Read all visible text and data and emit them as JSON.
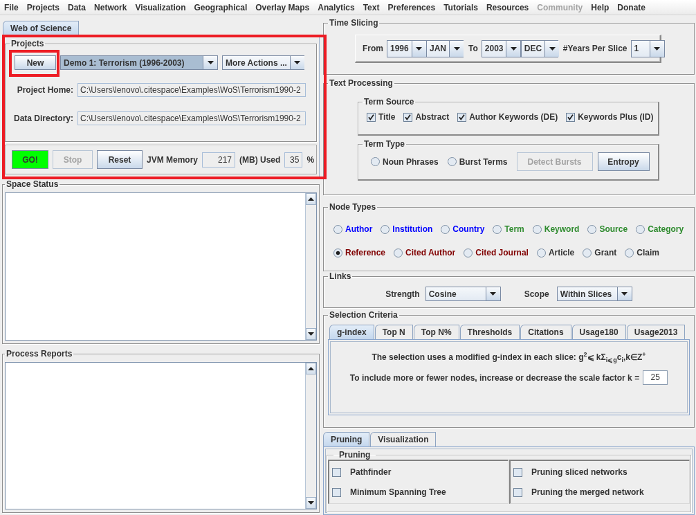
{
  "menu": [
    {
      "label": "File",
      "disabled": false
    },
    {
      "label": "Projects",
      "disabled": false
    },
    {
      "label": "Data",
      "disabled": false
    },
    {
      "label": "Network",
      "disabled": false
    },
    {
      "label": "Visualization",
      "disabled": false
    },
    {
      "label": "Geographical",
      "disabled": false
    },
    {
      "label": "Overlay Maps",
      "disabled": false
    },
    {
      "label": "Analytics",
      "disabled": false
    },
    {
      "label": "Text",
      "disabled": false
    },
    {
      "label": "Preferences",
      "disabled": false
    },
    {
      "label": "Tutorials",
      "disabled": false
    },
    {
      "label": "Resources",
      "disabled": false
    },
    {
      "label": "Community",
      "disabled": true
    },
    {
      "label": "Help",
      "disabled": false
    },
    {
      "label": "Donate",
      "disabled": false
    }
  ],
  "source_tabs": [
    {
      "label": "Web of Science",
      "selected": true
    }
  ],
  "project_panel": {
    "highlighted": true,
    "title": "Projects",
    "new_button": {
      "label": "New",
      "highlighted": true
    },
    "project_dropdown": {
      "value": "Demo 1: Terrorism (1996-2003)",
      "focused": true
    },
    "actions_dropdown": {
      "value": "More Actions ..."
    },
    "fields": [
      {
        "label": "Project Home:",
        "value": "C:\\Users\\lenovo\\.citespace\\Examples\\WoS\\Terrorism1990-2"
      },
      {
        "label": "Data Directory:",
        "value": "C:\\Users\\lenovo\\.citespace\\Examples\\WoS\\Terrorism1990-2"
      }
    ],
    "run_bar": {
      "buttons": [
        {
          "label": "GO!",
          "kind": "go",
          "disabled": false
        },
        {
          "label": "Stop",
          "kind": "push",
          "disabled": true
        },
        {
          "label": "Reset",
          "kind": "push",
          "disabled": false
        }
      ],
      "memory_label": "JVM Memory",
      "memory_value": "217",
      "used_label": "(MB) Used",
      "used_value": "35",
      "percent_label": "%"
    }
  },
  "space_status": {
    "title": "Space Status"
  },
  "process_reports": {
    "title": "Process Reports"
  },
  "time_slicing": {
    "title": "Time Slicing",
    "from_label": "From",
    "from_year": "1996",
    "from_month": "JAN",
    "to_label": "To",
    "to_year": "2003",
    "to_month": "DEC",
    "slice_label": "#Years Per Slice",
    "slice_value": "1"
  },
  "text_processing": {
    "title": "Text Processing",
    "term_source": {
      "title": "Term Source",
      "options": [
        {
          "label": "Title",
          "checked": true
        },
        {
          "label": "Abstract",
          "checked": true
        },
        {
          "label": "Author Keywords (DE)",
          "checked": true
        },
        {
          "label": "Keywords Plus (ID)",
          "checked": true
        }
      ]
    },
    "term_type": {
      "title": "Term Type",
      "options": [
        {
          "label": "Noun Phrases",
          "selected": false
        },
        {
          "label": "Burst Terms",
          "selected": false
        }
      ],
      "buttons": [
        {
          "label": "Detect Bursts",
          "disabled": true
        },
        {
          "label": "Entropy",
          "disabled": false
        }
      ]
    }
  },
  "node_types": {
    "title": "Node Types",
    "rows": [
      {
        "options": [
          {
            "label": "Author",
            "color": "#0000ff",
            "selected": false
          },
          {
            "label": "Institution",
            "color": "#0000ff",
            "selected": false
          },
          {
            "label": "Country",
            "color": "#0000ff",
            "selected": false
          },
          {
            "label": "Term",
            "color": "#2e8b2e",
            "selected": false
          },
          {
            "label": "Keyword",
            "color": "#2e8b2e",
            "selected": false
          },
          {
            "label": "Source",
            "color": "#2e8b2e",
            "selected": false
          },
          {
            "label": "Category",
            "color": "#2e8b2e",
            "selected": false
          }
        ]
      },
      {
        "options": [
          {
            "label": "Reference",
            "color": "#800000",
            "selected": true
          },
          {
            "label": "Cited Author",
            "color": "#800000",
            "selected": false
          },
          {
            "label": "Cited Journal",
            "color": "#800000",
            "selected": false
          },
          {
            "label": "Article",
            "color": "#333333",
            "selected": false
          },
          {
            "label": "Grant",
            "color": "#333333",
            "selected": false
          },
          {
            "label": "Claim",
            "color": "#333333",
            "selected": false
          }
        ]
      }
    ]
  },
  "links": {
    "title": "Links",
    "strength_label": "Strength",
    "strength_value": "Cosine",
    "scope_label": "Scope",
    "scope_value": "Within Slices"
  },
  "selection_criteria": {
    "title": "Selection Criteria",
    "tabs": [
      {
        "label": "g-index",
        "selected": true
      },
      {
        "label": "Top N",
        "selected": false
      },
      {
        "label": "Top N%",
        "selected": false
      },
      {
        "label": "Thresholds",
        "selected": false
      },
      {
        "label": "Citations",
        "selected": false
      },
      {
        "label": "Usage180",
        "selected": false
      },
      {
        "label": "Usage2013",
        "selected": false
      }
    ],
    "formula_text": "The selection uses a modified g-index in each slice: g$^{2}$⩽ kΣ$_{i⩽g}$c$_{i}$,k∈Z$^{+}$",
    "scale_text": "To include more or fewer nodes, increase or decrease the scale factor k =",
    "scale_value": "25"
  },
  "bottom_tabs": [
    {
      "label": "Pruning",
      "selected": true
    },
    {
      "label": "Visualization",
      "selected": false
    }
  ],
  "pruning": {
    "title": "Pruning",
    "columns": [
      {
        "options": [
          {
            "label": "Pathfinder",
            "checked": false
          },
          {
            "label": "Minimum Spanning Tree",
            "checked": false
          }
        ]
      },
      {
        "options": [
          {
            "label": "Pruning sliced networks",
            "checked": false
          },
          {
            "label": "Pruning the merged network",
            "checked": false
          }
        ]
      }
    ]
  }
}
